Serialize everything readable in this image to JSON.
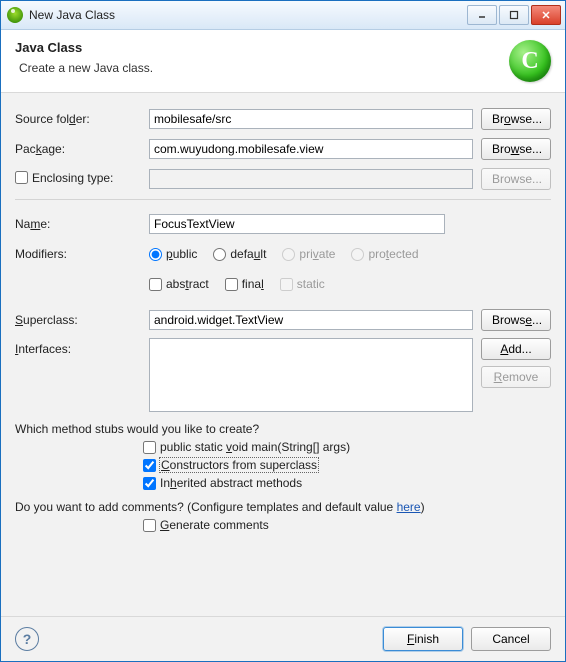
{
  "window": {
    "title": "New Java Class"
  },
  "banner": {
    "title": "Java Class",
    "subtitle": "Create a new Java class.",
    "icon_letter": "C"
  },
  "labels": {
    "source_folder": "Source folder:",
    "package": "Package:",
    "enclosing_type": "Enclosing type:",
    "name": "Name:",
    "modifiers": "Modifiers:",
    "superclass": "Superclass:",
    "interfaces": "Interfaces:"
  },
  "fields": {
    "source_folder": "mobilesafe/src",
    "package": "com.wuyudong.mobilesafe.view",
    "enclosing_type": "",
    "name": "FocusTextView",
    "superclass": "android.widget.TextView",
    "interfaces": ""
  },
  "buttons": {
    "browse": "Browse...",
    "add": "Add...",
    "remove": "Remove",
    "finish": "Finish",
    "cancel": "Cancel",
    "help": "?"
  },
  "modifiers": {
    "access": {
      "public": "public",
      "default": "default",
      "private": "private",
      "protected": "protected",
      "selected": "public"
    },
    "flags": {
      "abstract": {
        "label": "abstract",
        "checked": false
      },
      "final": {
        "label": "final",
        "checked": false
      },
      "static": {
        "label": "static",
        "checked": false,
        "disabled": true
      }
    }
  },
  "stubs": {
    "question": "Which method stubs would you like to create?",
    "main": {
      "label_pre": "public static ",
      "label_mn": "v",
      "label_post": "oid main(String[] args)",
      "checked": false
    },
    "constructors": {
      "label_pre": "",
      "label_mn": "C",
      "label_post": "onstructors from superclass",
      "checked": true,
      "focused": true
    },
    "inherited": {
      "label_pre": "In",
      "label_mn": "h",
      "label_post": "erited abstract methods",
      "checked": true
    }
  },
  "comments": {
    "question_pre": "Do you want to add comments? (Configure templates and default value ",
    "link_text": "here",
    "question_post": ")",
    "generate": {
      "label_pre": "",
      "label_mn": "G",
      "label_post": "enerate comments",
      "checked": false
    }
  },
  "mnemonics": {
    "browse_source": {
      "pre": "Br",
      "mn": "o",
      "post": "wse..."
    },
    "browse_package": {
      "pre": "Bro",
      "mn": "w",
      "post": "se..."
    },
    "browse_enclose": {
      "pre": "Browse...",
      "mn": "",
      "post": ""
    },
    "browse_super": {
      "pre": "Brows",
      "mn": "e",
      "post": "..."
    },
    "add": {
      "pre": "",
      "mn": "A",
      "post": "dd..."
    },
    "remove": {
      "pre": "",
      "mn": "R",
      "post": "emove"
    },
    "finish": {
      "pre": "",
      "mn": "F",
      "post": "inish"
    },
    "name_label": {
      "pre": "Na",
      "mn": "m",
      "post": "e:"
    },
    "package_label": {
      "pre": "Pac",
      "mn": "k",
      "post": "age:"
    },
    "source_label": {
      "pre": "Source fol",
      "mn": "d",
      "post": "er:"
    },
    "superclass_label": {
      "pre": "",
      "mn": "S",
      "post": "uperclass:"
    },
    "interfaces_label": {
      "pre": "",
      "mn": "I",
      "post": "nterfaces:"
    },
    "abstract": {
      "pre": "abs",
      "mn": "t",
      "post": "ract"
    },
    "final": {
      "pre": "fina",
      "mn": "l",
      "post": ""
    },
    "public": {
      "pre": "",
      "mn": "p",
      "post": "ublic"
    },
    "default": {
      "pre": "defa",
      "mn": "u",
      "post": "lt"
    },
    "private": {
      "pre": "pri",
      "mn": "v",
      "post": "ate"
    },
    "protected": {
      "pre": "pro",
      "mn": "t",
      "post": "ected"
    }
  }
}
